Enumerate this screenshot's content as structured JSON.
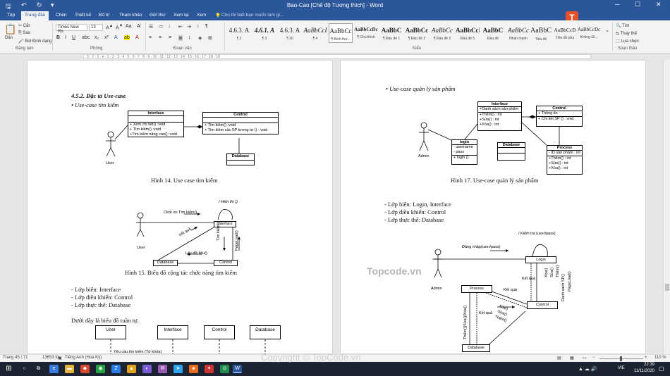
{
  "window": {
    "title": "Bao-Cao [Chế độ Tương thích] - Word"
  },
  "tabs": [
    "Tệp",
    "Trang đầu",
    "Chèn",
    "Thiết kế",
    "Bố trí",
    "Tham khảo",
    "Gửi thư",
    "Xem lại",
    "Xem"
  ],
  "tell_me": "Cho tôi biết bạn muốn làm gì...",
  "logo": {
    "text": "TOPCODE.VN",
    "mark": "T"
  },
  "ribbon": {
    "clipboard": {
      "paste": "Dán",
      "cut": "Cắt",
      "copy": "Sao",
      "format_painter": "Bút Định dạng",
      "group": "Bảng tạm"
    },
    "font": {
      "name": "Times New Ro",
      "size": "13",
      "group": "Phông"
    },
    "paragraph": {
      "group": "Đoạn văn"
    },
    "styles": {
      "group": "Kiểu",
      "items": [
        {
          "preview": "4.6.3.  A",
          "name": "¶ 2"
        },
        {
          "preview": "4.6.1.  A",
          "name": "¶ 3"
        },
        {
          "preview": "4.6.3.  A",
          "name": "¶ 30"
        },
        {
          "preview": "AaBbCcI",
          "name": "¶ 4"
        },
        {
          "preview": "AaBbCc",
          "name": "¶ Bình thư..."
        },
        {
          "preview": "AaBbCcDc",
          "name": "¶ Chú thích"
        },
        {
          "preview": "AaBbC",
          "name": "¶ Đầu đề 1"
        },
        {
          "preview": "AaBbCc",
          "name": "¶ Đầu đề 2"
        },
        {
          "preview": "AaBbCc",
          "name": "¶ Đầu đề 3"
        },
        {
          "preview": "AaBbCcI",
          "name": "Đầu đề 5"
        },
        {
          "preview": "AaBbC",
          "name": "Đầu đề"
        },
        {
          "preview": "AaBbCc",
          "name": "Nhấn mạnh"
        },
        {
          "preview": "AaBbC",
          "name": "Tiêu đề"
        },
        {
          "preview": "AaBbCcD",
          "name": "Tiêu đề phụ"
        },
        {
          "preview": "AaBbCcDc",
          "name": "Không Gi..."
        }
      ]
    },
    "editing": {
      "find": "Tìm",
      "replace": "Thay thế",
      "select": "Lựa chọn",
      "group": "Soạn thảo"
    }
  },
  "ruler": {
    "text": "3 · 2 · 1 · ▾ · 1 · 2 · 3 · 4 · 5 · 6 · 7 · 8 · 9 · 10 · 11 · 12 · 13 · 14 · 15 · 16 · 17 · 18 · 19"
  },
  "page_left": {
    "heading": "4.5.2. Đặc tả Use-case",
    "bullet1": "• Use-case tìm kiếm",
    "fig14": {
      "interface": {
        "title": "Interface",
        "rows": [
          "+ Xem chi tiết() :void",
          "+ Tìm kiếm() :void",
          "+Tìm kiếm nâng cao() :void"
        ]
      },
      "control": {
        "title": "Control",
        "rows": [
          "+ Tìm kiếm() :void",
          "+ Tìm kiếm các SP tương tự () : void"
        ]
      },
      "database": "Database",
      "actor": "User",
      "caption": "Hình 14. Use case tìm kiếm"
    },
    "fig15": {
      "self_msg": "/ Hiển thị ()",
      "click_msg": "Click on Tìm kiếm()",
      "interface": "Interface",
      "result": "Kết quả",
      "get_info": "Lấy dữ liệu()",
      "search_msg": "Tìm kiếm()",
      "pageload": "PageLoad()",
      "database": "Database",
      "control": "Control",
      "actor": "User",
      "caption": "Hình 15. Biểu đồ cộng tác chức năng tìm kiếm"
    },
    "classes": [
      "- Lớp biên: Interface",
      "- Lớp điều khiển: Control",
      "- Lớp thực thể: Database"
    ],
    "seq_intro": "Dưới đây là biểu đồ tuần tự.",
    "seq": {
      "lifelines": [
        "User",
        "Interface",
        "Control",
        "Database"
      ],
      "msg": "Yêu cầu tìm kiếm (Từ khóa)"
    }
  },
  "page_right": {
    "bullet1": "• Use-case quản lý sản phẩm",
    "fig17": {
      "interface": {
        "title": "Interface",
        "rows": [
          "+Danh sách sản phẩm",
          "+Thêm() : int",
          "+Sửa() : int",
          "+Xóa() : int"
        ]
      },
      "control": {
        "title": "Control",
        "rows": [
          "+ Thông tin",
          "+ Chi tiết SP () : void"
        ]
      },
      "login": {
        "title": "login",
        "rows": [
          "- username",
          "- pass",
          "+ login ()"
        ]
      },
      "database": "Database",
      "process": {
        "title": "Process",
        "rows": [
          "- ID sản phẩm : int",
          "+Thêm() : int",
          "+Sửa() : int",
          "+Xóa() : int"
        ]
      },
      "actor": "Admin",
      "caption": "Hình 17. Use-case quản lý sản phẩm"
    },
    "classes": [
      "- Lớp biên: Login, Interface",
      "- Lớp điều khiển: Control",
      "- Lớp thực thể: Database"
    ],
    "fig18": {
      "self_msg": "/ Kiểm tra (user/pass)",
      "login_msg": "Đăng nhập(user/pass)",
      "login": "Login",
      "result1": "Kết quả",
      "process": "Process",
      "result2": "Kết quả",
      "control": "Control",
      "result3": "Kết quả",
      "ops": [
        "Xóa()",
        "Sửa()",
        "Thêm()"
      ],
      "ops2": [
        "Xóa()",
        "Sửa()",
        "Thêm()"
      ],
      "list": "Danh sách SP()",
      "pageload": "PageLoad()",
      "crud": "Thêm()|Sửa()|Xóa()",
      "database": "Database",
      "actor": "Admin"
    }
  },
  "watermark": {
    "center": "Topcode.vn",
    "bottom": "Copyright © TopCode.vn"
  },
  "status": {
    "page": "Trang 45 / 71",
    "words": "13653 từ",
    "lang": "Tiếng Anh (Hoa Kỳ)",
    "zoom": "110 %"
  },
  "taskbar": {
    "lang": "VIE",
    "time": "22:39",
    "date": "11/11/2020"
  }
}
